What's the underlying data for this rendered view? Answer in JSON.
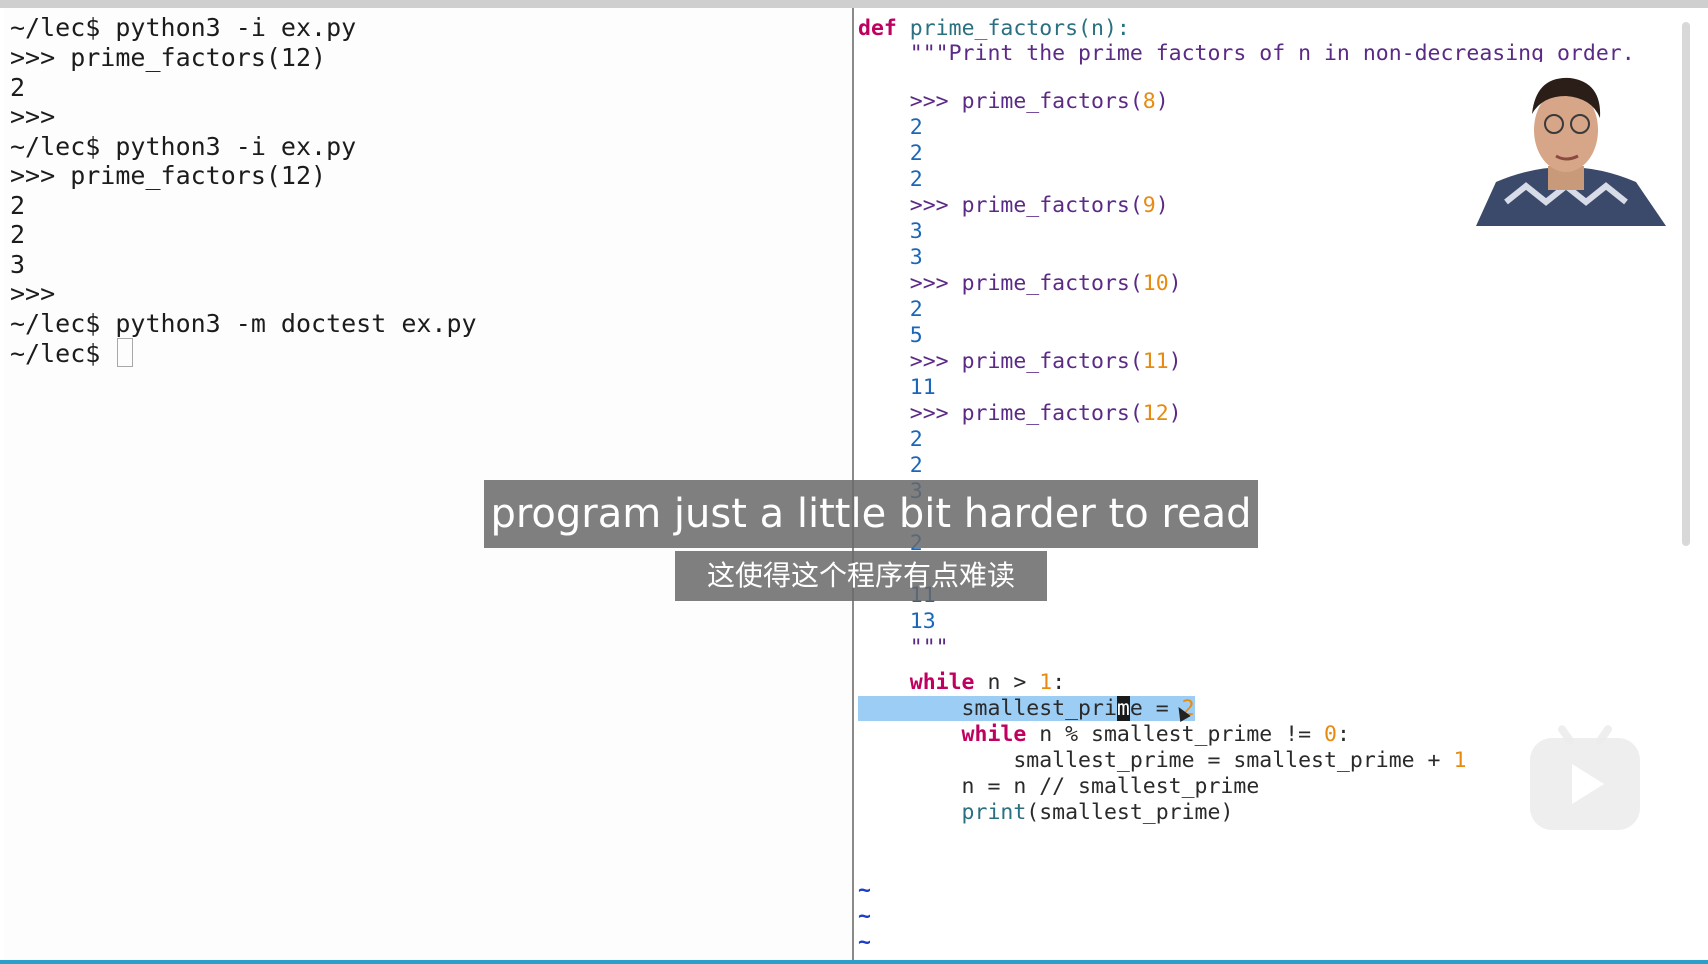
{
  "terminal": {
    "lines": [
      "~/lec$ python3 -i ex.py",
      ">>> prime_factors(12)",
      "2",
      ">>>",
      "~/lec$ python3 -i ex.py",
      ">>> prime_factors(12)",
      "2",
      "2",
      "3",
      ">>>",
      "~/lec$ python3 -m doctest ex.py",
      "~/lec$ "
    ]
  },
  "editor": {
    "def_kw": "def",
    "func_sig": " prime_factors(n):",
    "docstring_first": "    \"\"\"Print the prime factors of n in non-decreasing order.",
    "examples": [
      {
        "prompt": "    >>> ",
        "call": "prime_factors(",
        "arg": "8",
        "close": ")",
        "outputs": [
          "2",
          "2",
          "2"
        ]
      },
      {
        "prompt": "    >>> ",
        "call": "prime_factors(",
        "arg": "9",
        "close": ")",
        "outputs": [
          "3",
          "3"
        ]
      },
      {
        "prompt": "    >>> ",
        "call": "prime_factors(",
        "arg": "10",
        "close": ")",
        "outputs": [
          "2",
          "5"
        ]
      },
      {
        "prompt": "    >>> ",
        "call": "prime_factors(",
        "arg": "11",
        "close": ")",
        "outputs": [
          "11"
        ]
      },
      {
        "prompt": "    >>> ",
        "call": "prime_factors(",
        "arg": "12",
        "close": ")",
        "outputs": [
          "2",
          "2",
          "3"
        ]
      }
    ],
    "hidden_lines": [
      "2",
      "11",
      "13"
    ],
    "doc_close": "    \"\"\"",
    "code": {
      "while1_kw": "    while",
      "while1_rest": " n > ",
      "while1_num": "1",
      "while1_colon": ":",
      "assign_pre": "        smallest_pri",
      "assign_cursor": "m",
      "assign_post": "e = ",
      "assign_num": "2",
      "while2_kw": "        while",
      "while2_rest": " n % smallest_prime != ",
      "while2_num": "0",
      "while2_colon": ":",
      "inc_pre": "            smallest_prime = smallest_prime + ",
      "inc_num": "1",
      "div_line": "        n = n // smallest_prime",
      "print_fn": "        print",
      "print_rest": "(smallest_prime)"
    },
    "tilde": "~"
  },
  "subtitles": {
    "english": "program just a little bit harder to read",
    "chinese": "这使得这个程序有点难读"
  },
  "colors": {
    "keyword": "#c00060",
    "number": "#e88a10",
    "output": "#1a66b8",
    "selection": "#9ccdf5"
  }
}
